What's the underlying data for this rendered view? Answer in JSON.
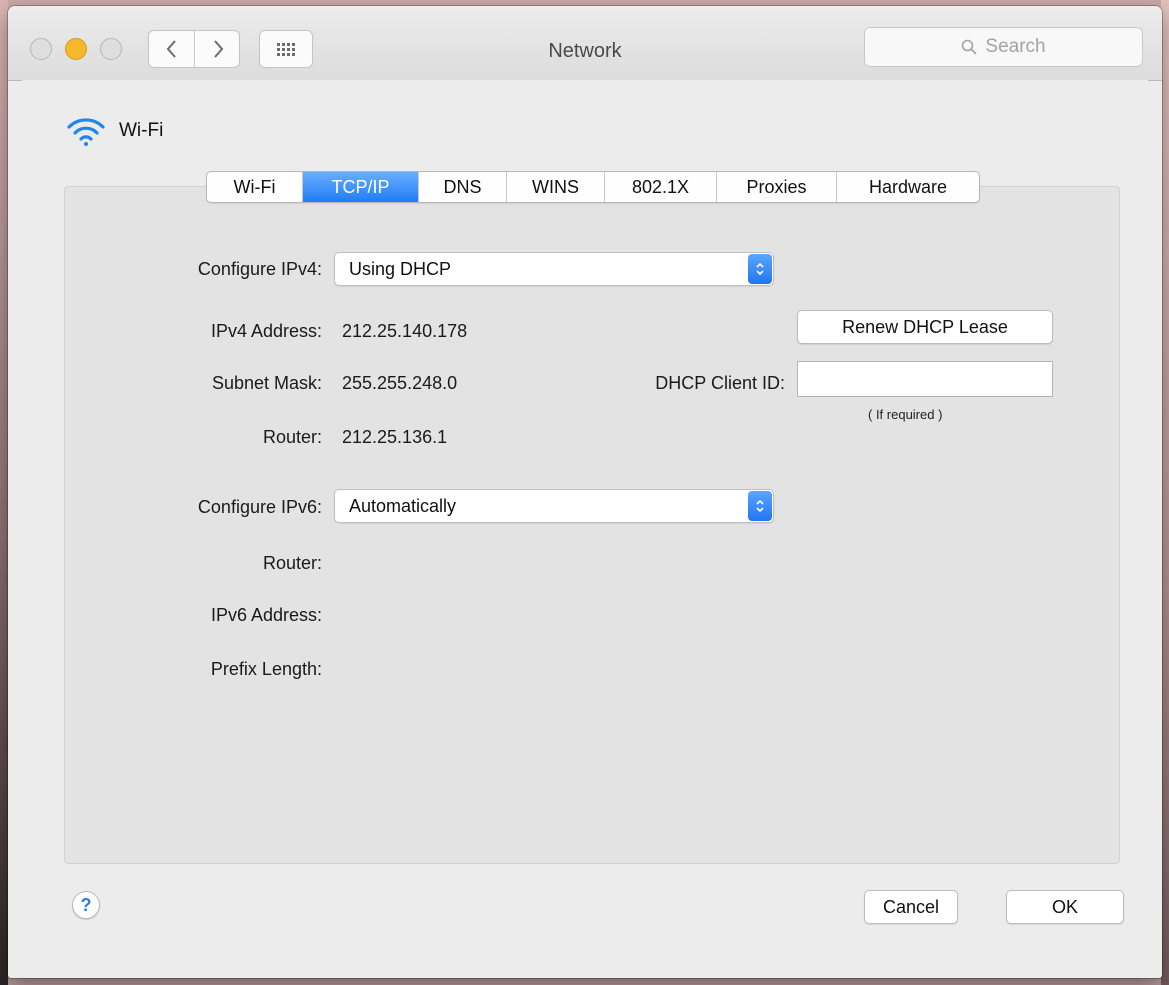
{
  "window": {
    "title": "Network",
    "search_placeholder": "Search"
  },
  "header": {
    "service_name": "Wi-Fi",
    "service_icon": "wifi-icon"
  },
  "tabs": [
    {
      "label": "Wi-Fi",
      "active": false
    },
    {
      "label": "TCP/IP",
      "active": true
    },
    {
      "label": "DNS",
      "active": false
    },
    {
      "label": "WINS",
      "active": false
    },
    {
      "label": "802.1X",
      "active": false
    },
    {
      "label": "Proxies",
      "active": false
    },
    {
      "label": "Hardware",
      "active": false
    }
  ],
  "ipv4": {
    "configure_label": "Configure IPv4:",
    "configure_value": "Using DHCP",
    "address_label": "IPv4 Address:",
    "address_value": "212.25.140.178",
    "subnet_label": "Subnet Mask:",
    "subnet_value": "255.255.248.0",
    "router_label": "Router:",
    "router_value": "212.25.136.1",
    "renew_button": "Renew DHCP Lease",
    "client_id_label": "DHCP Client ID:",
    "client_id_value": "",
    "client_id_hint": "( If required )"
  },
  "ipv6": {
    "configure_label": "Configure IPv6:",
    "configure_value": "Automatically",
    "router_label": "Router:",
    "address_label": "IPv6 Address:",
    "prefix_label": "Prefix Length:"
  },
  "footer": {
    "help_label": "?",
    "cancel": "Cancel",
    "ok": "OK"
  },
  "colors": {
    "accent": "#1f7cf6",
    "minimize": "#f4b72e"
  }
}
